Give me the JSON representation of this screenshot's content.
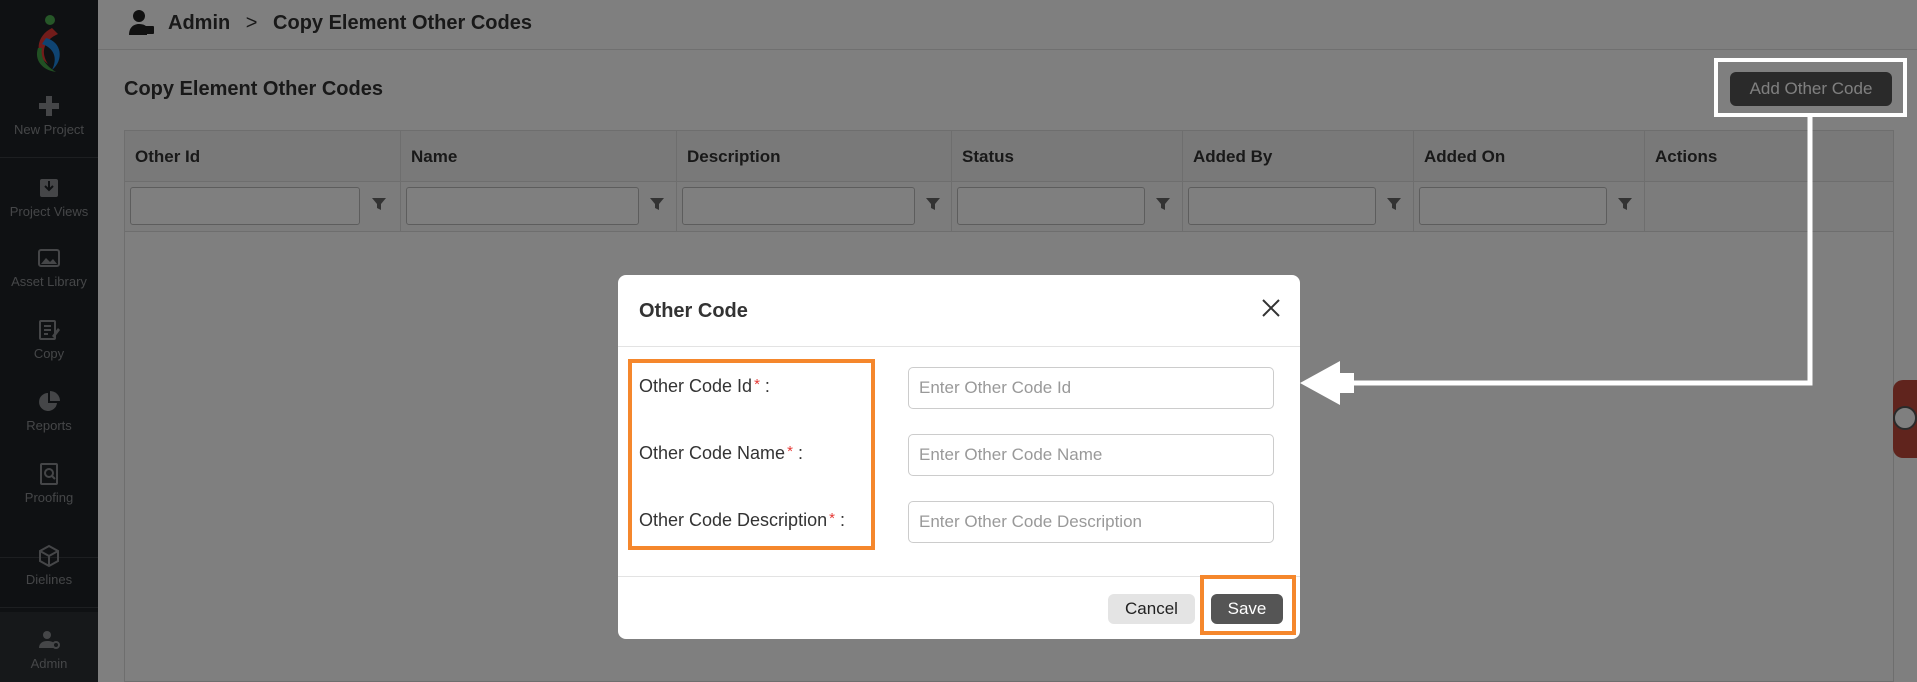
{
  "sidebar": {
    "items": [
      {
        "label": "New Project",
        "icon": "plus-icon"
      },
      {
        "label": "Project Views",
        "icon": "inbox-icon"
      },
      {
        "label": "Asset Library",
        "icon": "image-icon"
      },
      {
        "label": "Copy",
        "icon": "edit-icon"
      },
      {
        "label": "Reports",
        "icon": "pie-chart-icon"
      },
      {
        "label": "Proofing",
        "icon": "proof-search-icon"
      },
      {
        "label": "Dielines",
        "icon": "box-icon"
      },
      {
        "label": "Admin",
        "icon": "admin-user-icon"
      }
    ]
  },
  "header": {
    "breadcrumb_root": "Admin",
    "breadcrumb_sep": ">",
    "breadcrumb_current": "Copy Element Other Codes"
  },
  "main": {
    "page_title": "Copy Element Other Codes",
    "add_button": "Add Other Code",
    "columns": [
      "Other Id",
      "Name",
      "Description",
      "Status",
      "Added By",
      "Added On",
      "Actions"
    ]
  },
  "modal": {
    "title": "Other Code",
    "fields": [
      {
        "label": "Other Code Id",
        "required_mark": "*",
        "suffix": ":",
        "placeholder": "Enter Other Code Id"
      },
      {
        "label": "Other Code Name",
        "required_mark": "*",
        "suffix": ":",
        "placeholder": "Enter Other Code Name"
      },
      {
        "label": "Other Code Description",
        "required_mark": "*",
        "suffix": ":",
        "placeholder": "Enter Other Code Description"
      }
    ],
    "cancel_label": "Cancel",
    "save_label": "Save"
  },
  "colors": {
    "sidebar_bg": "#1f2326",
    "button_dark": "#555555",
    "highlight_orange": "#f5872c",
    "required_red": "#e53935"
  }
}
